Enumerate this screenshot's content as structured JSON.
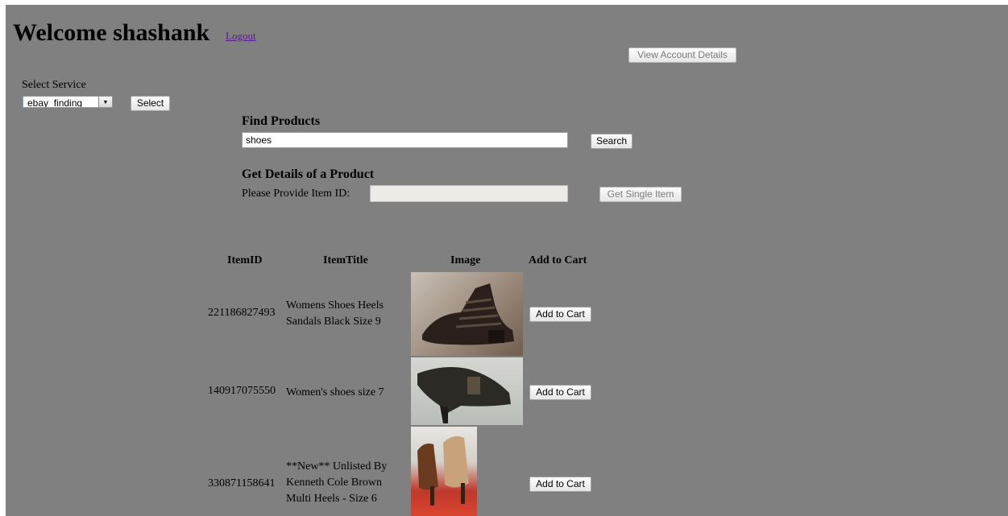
{
  "header": {
    "welcome": "Welcome shashank",
    "logout": "Logout",
    "view_account": "View Account Details"
  },
  "service": {
    "label": "Select Service",
    "selected": "ebay_finding",
    "select_button": "Select"
  },
  "find": {
    "heading": "Find Products",
    "query": "shoes",
    "search_button": "Search"
  },
  "details": {
    "heading": "Get Details of a Product",
    "label": "Please Provide Item ID:",
    "item_id": "",
    "button": "Get Single Item"
  },
  "table": {
    "headers": [
      "ItemID",
      "ItemTitle",
      "Image",
      "Add to Cart"
    ],
    "rows": [
      {
        "id": "221186827493",
        "title": "Womens Shoes Heels Sandals Black Size 9",
        "cart": "Add to Cart"
      },
      {
        "id": "140917075550",
        "title": "Women's shoes size 7",
        "cart": "Add to Cart"
      },
      {
        "id": "330871158641",
        "title": "**New** Unlisted By Kenneth Cole Brown Multi Heels - Size 6",
        "cart": "Add to Cart"
      }
    ]
  },
  "colors": {
    "page_bg": "#808080",
    "link": "#551a8b"
  }
}
